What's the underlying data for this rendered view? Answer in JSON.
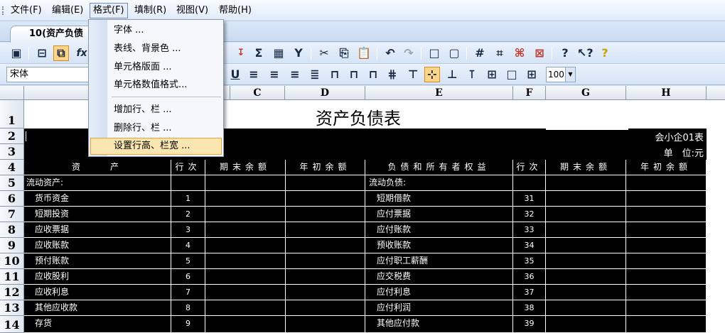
{
  "menubar": {
    "items": [
      {
        "label": "文件(F)"
      },
      {
        "label": "编辑(E)"
      },
      {
        "label": "格式(F)"
      },
      {
        "label": "填制(R)"
      },
      {
        "label": "视图(V)"
      },
      {
        "label": "帮助(H)"
      }
    ]
  },
  "format_menu": {
    "items": [
      "字体 ...",
      "表线、背景色 ...",
      "单元格版面 ...",
      "单元格数值格式...",
      "增加行、栏 ...",
      "删除行、栏 ...",
      "设置行高、栏宽 ..."
    ]
  },
  "tab": {
    "label": "10(资产负债"
  },
  "toolbar": {
    "font_name": "宋体",
    "zoom": "100",
    "fx_label": "fx"
  },
  "sheet": {
    "columns": [
      "C",
      "D",
      "E",
      "F",
      "G",
      "H"
    ],
    "rows": [
      "1",
      "2",
      "3",
      "4",
      "5",
      "6",
      "7",
      "8",
      "9",
      "10",
      "11",
      "12",
      "13",
      "14"
    ],
    "title": "资产负债表",
    "form_code": "会小企01表",
    "unit": "单　位:元",
    "headers": [
      "资　　产",
      "行次",
      "期末余额",
      "年初余额",
      "负债和所有者权益",
      "行次",
      "期末余额",
      "年初余额"
    ],
    "section_left": "流动资产:",
    "section_right": "流动负债:",
    "assets": [
      {
        "name": "货币资金",
        "line": "1"
      },
      {
        "name": "短期投资",
        "line": "2"
      },
      {
        "name": "应收票据",
        "line": "3"
      },
      {
        "name": "应收账款",
        "line": "4"
      },
      {
        "name": "预付账款",
        "line": "5"
      },
      {
        "name": "应收股利",
        "line": "6"
      },
      {
        "name": "应收利息",
        "line": "7"
      },
      {
        "name": "其他应收款",
        "line": "8"
      },
      {
        "name": "存货",
        "line": "9"
      }
    ],
    "liabilities": [
      {
        "name": "短期借款",
        "line": "31"
      },
      {
        "name": "应付票据",
        "line": "32"
      },
      {
        "name": "应付账款",
        "line": "33"
      },
      {
        "name": "预收账款",
        "line": "34"
      },
      {
        "name": "应付职工薪酬",
        "line": "35"
      },
      {
        "name": "应交税费",
        "line": "36"
      },
      {
        "name": "应付利息",
        "line": "37"
      },
      {
        "name": "应付利润",
        "line": "38"
      },
      {
        "name": "其他应付款",
        "line": "39"
      }
    ]
  },
  "icons": [
    "save-icon",
    "print-preview-icon",
    "copy-format-icon",
    "fx-icon",
    "sum-icon",
    "calculator-icon",
    "filter-icon",
    "cut-icon",
    "copy-icon",
    "paste-icon",
    "undo-icon",
    "redo-icon",
    "border-icon",
    "grid-icon",
    "help-icon"
  ]
}
